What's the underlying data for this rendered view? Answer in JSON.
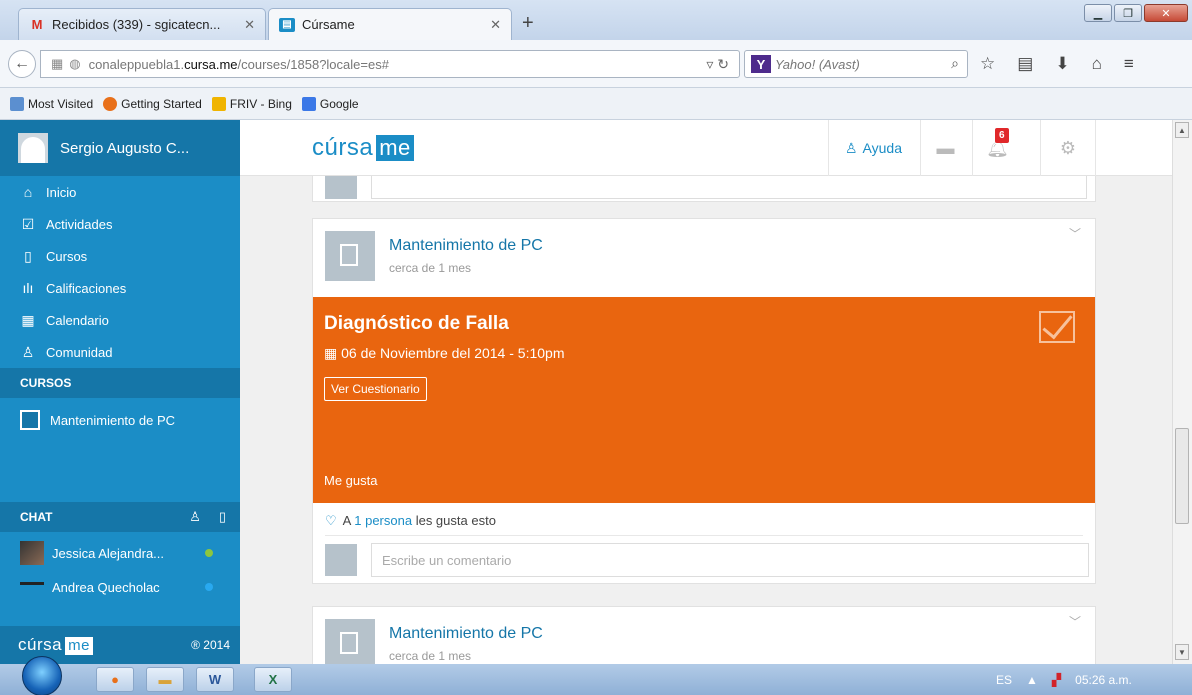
{
  "browser": {
    "tabs": [
      {
        "label": "Recibidos (339) - sgicatecn...",
        "icon": "gmail-icon"
      },
      {
        "label": "Cúrsame",
        "icon": "cursame-favicon"
      }
    ],
    "url_prefix": "conaleppuebla1.",
    "url_domain": "cursa.me",
    "url_suffix": "/courses/1858?locale=es#",
    "search_placeholder": "Yahoo! (Avast)",
    "bookmarks": [
      "Most Visited",
      "Getting Started",
      "FRIV - Bing",
      "Google"
    ]
  },
  "sidebar": {
    "user_name": "Sergio Augusto C...",
    "nav": [
      {
        "label": "Inicio",
        "icon": "home-icon"
      },
      {
        "label": "Actividades",
        "icon": "checkbox-icon"
      },
      {
        "label": "Cursos",
        "icon": "book-icon"
      },
      {
        "label": "Calificaciones",
        "icon": "bar-chart-icon"
      },
      {
        "label": "Calendario",
        "icon": "calendar-icon"
      },
      {
        "label": "Comunidad",
        "icon": "user-icon"
      }
    ],
    "courses_heading": "CURSOS",
    "course_name": "Mantenimiento de PC",
    "chat_heading": "CHAT",
    "chat_users": [
      {
        "name": "Jessica Alejandra...",
        "status_color": "#8cc63f"
      },
      {
        "name": "Andrea Quecholac",
        "status_color": "#29a9f0"
      }
    ],
    "footer_logo_text": "cúrsa",
    "footer_logo_me": "me",
    "copyright": "® 2014"
  },
  "header": {
    "logo_text": "cúrsa",
    "logo_me": "me",
    "help_label": "Ayuda",
    "notification_count": "6"
  },
  "posts": [
    {
      "course": "Mantenimiento de PC",
      "time_ago": "cerca de 1 mes",
      "activity_title": "Diagnóstico de Falla",
      "activity_date": "06 de Noviembre del 2014 - 5:10pm",
      "action_button": "Ver Cuestionario",
      "like_label": "Me gusta",
      "likes_prefix": "A",
      "likes_link": "1 persona",
      "likes_suffix": "les gusta esto",
      "comment_placeholder": "Escribe un comentario"
    },
    {
      "course": "Mantenimiento de PC",
      "time_ago": "cerca de 1 mes"
    }
  ],
  "taskbar": {
    "language": "ES",
    "clock": "05:26 a.m."
  },
  "colors": {
    "sidebar_blue": "#1b8dc6",
    "activity_orange": "#e9650f",
    "badge_red": "#e0282a"
  }
}
